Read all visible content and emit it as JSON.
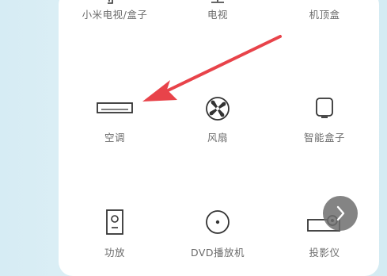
{
  "devices": [
    {
      "label": "小米电视/盒子",
      "icon": "tv-box-icon"
    },
    {
      "label": "电视",
      "icon": "tv-icon"
    },
    {
      "label": "机顶盒",
      "icon": "set-top-box-icon"
    },
    {
      "label": "空调",
      "icon": "air-conditioner-icon"
    },
    {
      "label": "风扇",
      "icon": "fan-icon"
    },
    {
      "label": "智能盒子",
      "icon": "smart-box-icon"
    },
    {
      "label": "功放",
      "icon": "amplifier-icon"
    },
    {
      "label": "DVD播放机",
      "icon": "dvd-player-icon"
    },
    {
      "label": "投影仪",
      "icon": "projector-icon"
    }
  ],
  "colors": {
    "arrow": "#e8434a",
    "icon_stroke": "#333333",
    "label": "#6b6b6b",
    "next_button": "#6e6e6e"
  }
}
